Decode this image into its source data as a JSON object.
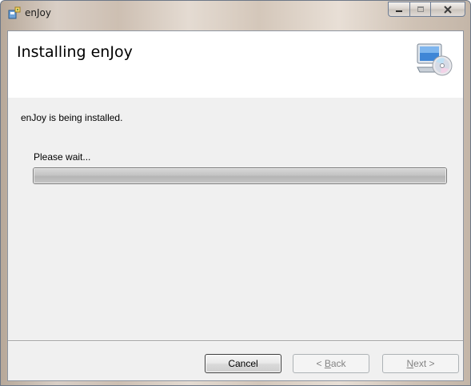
{
  "window": {
    "title": "enJoy",
    "icon": "installer-icon",
    "caption_buttons": [
      "minimize-icon",
      "maximize-icon",
      "close-icon"
    ]
  },
  "banner": {
    "title": "Installing enJoy",
    "icon": "computer-cd-icon"
  },
  "body": {
    "status": "enJoy is being installed.",
    "wait_label": "Please wait...",
    "progress": 1.0
  },
  "buttons": {
    "cancel": "Cancel",
    "back_prefix": "< ",
    "back_mnemonic": "B",
    "back_rest": "ack",
    "next_mnemonic": "N",
    "next_rest": "ext >"
  },
  "colors": {
    "banner_bg": "#ffffff",
    "client_bg": "#f0f0f0",
    "disabled_text": "#838383"
  }
}
